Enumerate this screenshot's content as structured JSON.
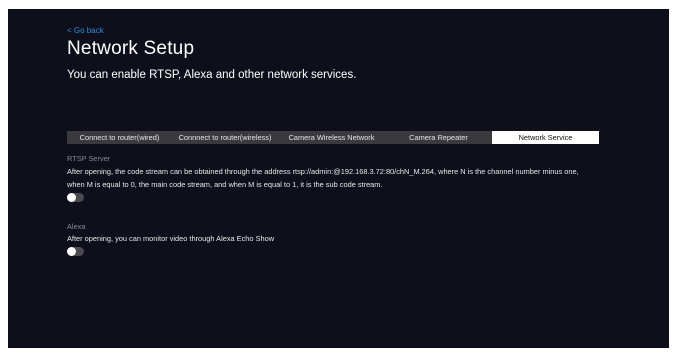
{
  "header": {
    "back_label": "< Go back",
    "title": "Network Setup",
    "subtitle": "You can enable RTSP, Alexa and other network services."
  },
  "tabs": [
    {
      "label": "Connect to router(wired)",
      "active": false
    },
    {
      "label": "Connnect to router(wireless)",
      "active": false
    },
    {
      "label": "Camera Wireless Network",
      "active": false
    },
    {
      "label": "Camera Repeater",
      "active": false
    },
    {
      "label": "Network Service",
      "active": true
    }
  ],
  "rtsp": {
    "label": "RTSP Server",
    "description_line1": "After opening, the code stream can be obtained through the address rtsp://admin:@192.168.3.72:80/chN_M.264, where N is the channel number minus one,",
    "description_line2": "when M is equal to 0, the main code stream, and when M is equal to 1, it is the sub code stream.",
    "enabled": false
  },
  "alexa": {
    "label": "Alexa",
    "description": "After opening, you can monitor video through Alexa Echo Show",
    "enabled": false
  },
  "colors": {
    "background": "#0e0f1a",
    "accent": "#2d8fe0",
    "tab_bar": "#3a3a3e",
    "active_tab": "#ffffff"
  }
}
